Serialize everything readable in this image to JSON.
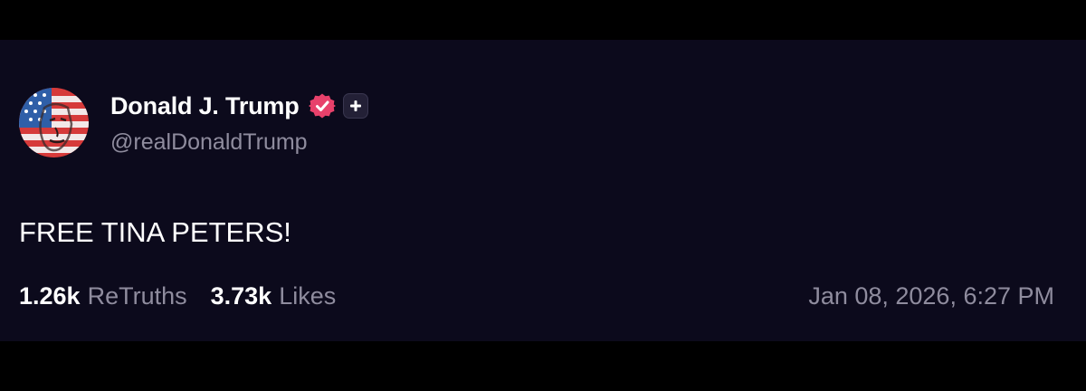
{
  "post": {
    "author": {
      "display_name": "Donald J. Trump",
      "handle": "@realDonaldTrump",
      "verified": true,
      "verified_icon": "verified-badge-icon",
      "follow_icon": "plus-icon"
    },
    "text": "FREE TINA PETERS!",
    "stats": {
      "retruths_count": "1.26k",
      "retruths_label": "ReTruths",
      "likes_count": "3.73k",
      "likes_label": "Likes"
    },
    "timestamp": "Jan 08, 2026, 6:27 PM"
  },
  "colors": {
    "background": "#0c0a1c",
    "letterbox": "#000000",
    "primary_text": "#ffffff",
    "secondary_text": "#8f8c9e",
    "verified_badge": "#e8416b"
  }
}
